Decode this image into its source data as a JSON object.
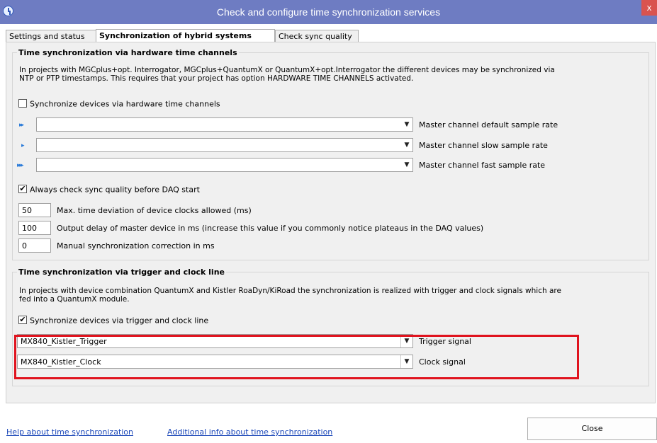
{
  "window": {
    "title": "Check and configure time synchronization services",
    "close_glyph": "x"
  },
  "tabs": [
    {
      "label": "Settings and status",
      "active": false
    },
    {
      "label": "Synchronization of hybrid systems",
      "active": true
    },
    {
      "label": "Check sync quality",
      "active": false
    }
  ],
  "hw_section": {
    "title": "Time synchronization via hardware time channels",
    "description_line1": "In projects with MGCplus+opt. Interrogator, MGCplus+QuantumX or QuantumX+opt.Interrogator the different devices may be synchronized via",
    "description_line2": "NTP or PTP timestamps. This requires that your project has option HARDWARE TIME CHANNELS activated.",
    "sync_checkbox": {
      "label": "Synchronize devices via hardware time channels",
      "checked": false
    },
    "channels": [
      {
        "icon": "default-rate-icon",
        "glyph": "▸▸",
        "value": "",
        "label": "Master channel default sample rate"
      },
      {
        "icon": "slow-rate-icon",
        "glyph": "▸",
        "value": "",
        "label": "Master channel slow sample rate"
      },
      {
        "icon": "fast-rate-icon",
        "glyph": "▸▸▸",
        "value": "",
        "label": "Master channel fast sample rate"
      }
    ],
    "quality_checkbox": {
      "label": "Always check sync quality before DAQ start",
      "checked": true
    },
    "params": [
      {
        "value": "50",
        "label": "Max. time deviation of device clocks allowed (ms)"
      },
      {
        "value": "100",
        "label": "Output delay of master device in ms (increase this value if you commonly notice plateaus in the DAQ values)"
      },
      {
        "value": "0",
        "label": "Manual synchronization correction in ms"
      }
    ]
  },
  "trigger_section": {
    "title": "Time synchronization via trigger and clock line",
    "description_line1": "In projects with device combination QuantumX and Kistler RoaDyn/KiRoad the synchronization is realized with trigger and clock signals which are",
    "description_line2": "fed into a QuantumX module.",
    "sync_checkbox": {
      "label": "Synchronize devices via trigger and clock line",
      "checked": true
    },
    "trigger": {
      "value": "MX840_Kistler_Trigger",
      "label": "Trigger signal"
    },
    "clock": {
      "value": "MX840_Kistler_Clock",
      "label": "Clock signal"
    }
  },
  "footer": {
    "help_link": "Help about time synchronization",
    "info_link": "Additional info about time synchronization",
    "close_button": "Close"
  },
  "colors": {
    "title_bar": "#6e7cc2",
    "highlight": "#e0131e",
    "link": "#1a46b8",
    "icon_accent": "#2b7bd8"
  }
}
